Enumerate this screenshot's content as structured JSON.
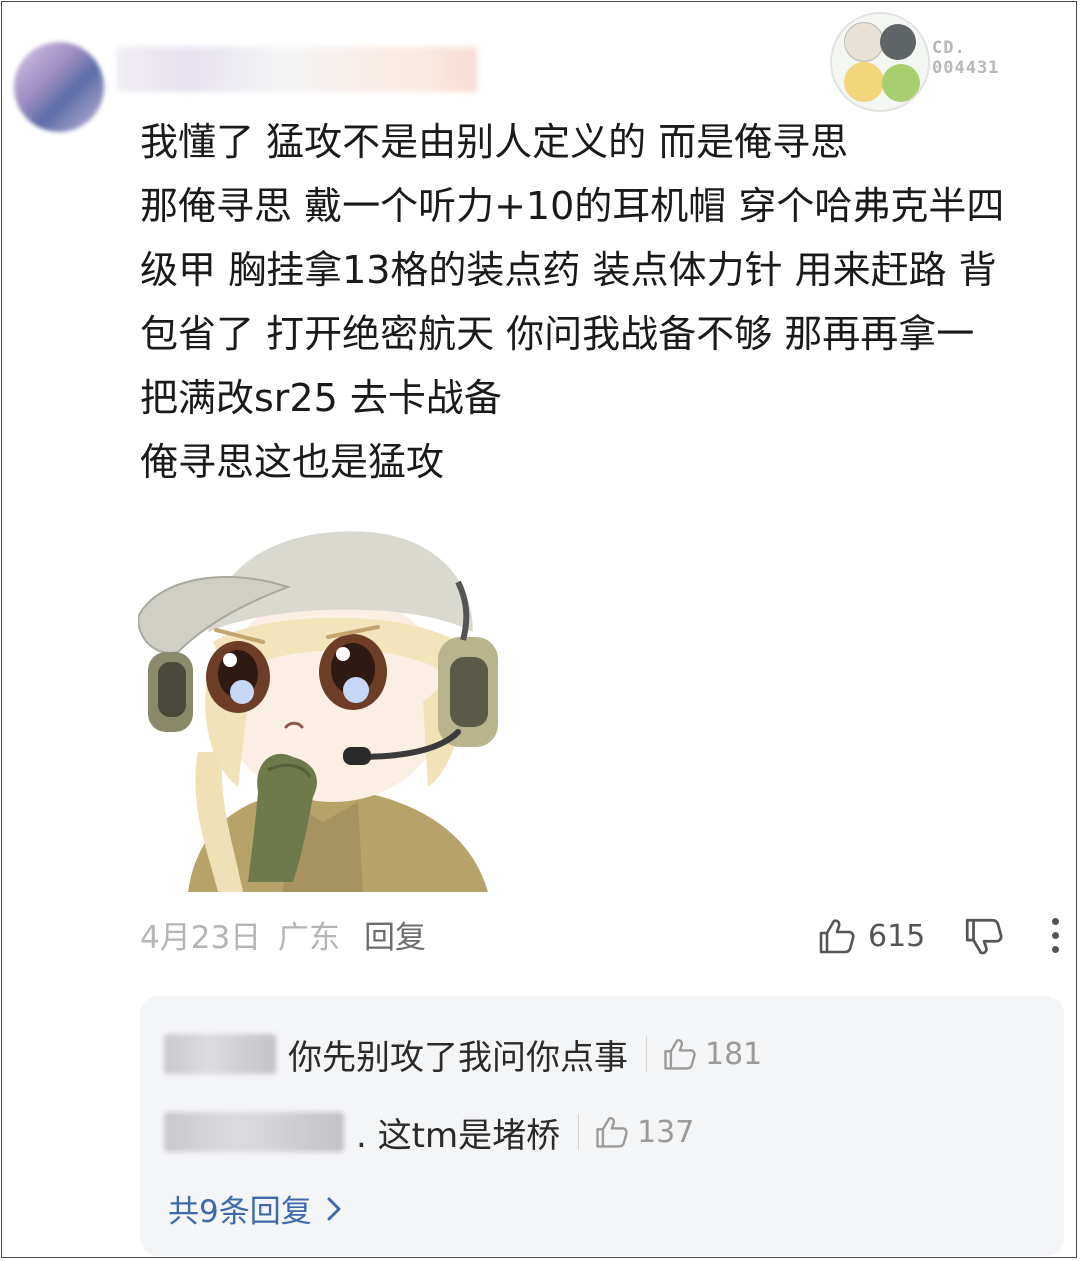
{
  "header": {
    "badge_code_line1": "CD.",
    "badge_code_line2": "004431"
  },
  "comment": {
    "lines": [
      "我懂了 猛攻不是由别人定义的 而是俺寻思",
      "那俺寻思 戴一个听力+10的耳机帽 穿个哈弗克半四",
      "级甲 胸挂拿13格的装点药 装点体力针 用来赶路 背",
      "包省了 打开绝密航天 你问我战备不够 那再再拿一",
      "把满改sr25 去卡战备",
      "俺寻思这也是猛攻"
    ],
    "date": "4月23日",
    "location": "广东",
    "reply_label": "回复",
    "like_count": "615"
  },
  "replies": {
    "items": [
      {
        "text": "你先别攻了我问你点事",
        "likes": "181"
      },
      {
        "text": ". 这tm是堵桥",
        "likes": "137"
      }
    ],
    "more_label": "共9条回复"
  },
  "colors": {
    "text": "#1a1a1a",
    "meta": "#b5b5b5",
    "link": "#3e6aa8",
    "panel": "#f4f5f7"
  }
}
